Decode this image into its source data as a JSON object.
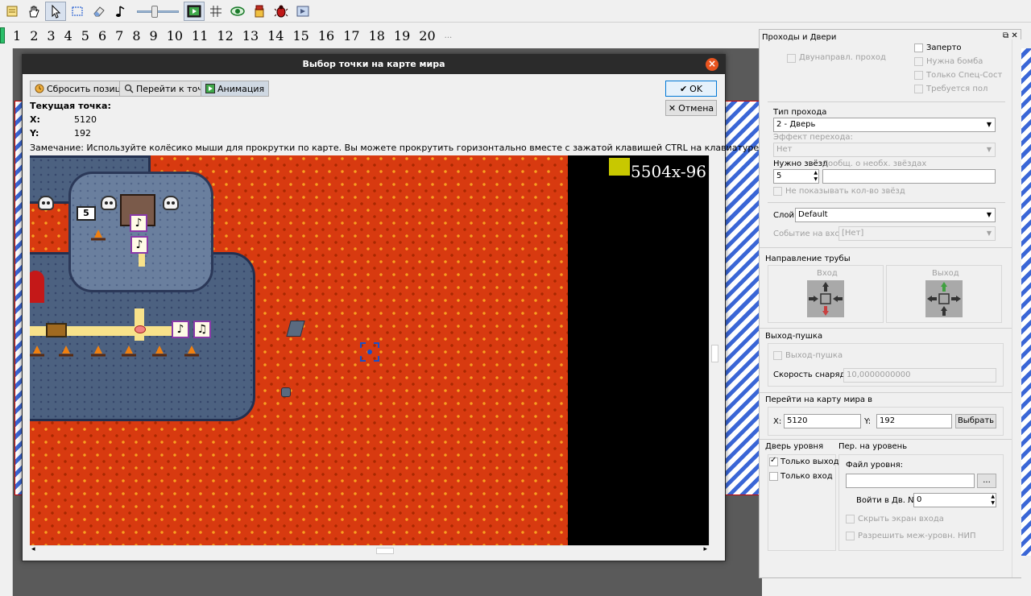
{
  "toolbar": {
    "icons": [
      "list-icon",
      "hand-icon",
      "pointer-icon",
      "select-rect-icon",
      "eraser-icon",
      "music-note-icon",
      "zoom-slider",
      "play-level-icon",
      "grid-icon",
      "eye-icon",
      "bucket-icon",
      "bug-icon",
      "animation-icon"
    ]
  },
  "layers": {
    "numbers": [
      "1",
      "2",
      "3",
      "4",
      "5",
      "6",
      "7",
      "8",
      "9",
      "10",
      "11",
      "12",
      "13",
      "14",
      "15",
      "16",
      "17",
      "18",
      "19",
      "20"
    ],
    "more": "..."
  },
  "dialog": {
    "title": "Выбор точки на карте мира",
    "reset_position": "Сбросить позицию",
    "goto_point": "Перейти к точке",
    "animation": "Анимация",
    "ok": "OK",
    "cancel": "Отмена",
    "current_point_label": "Текущая точка:",
    "x_label": "X:",
    "x_value": "5120",
    "y_label": "Y:",
    "y_value": "192",
    "note": "Замечание: Используйте колёсико мыши для прокрутки по карте. Вы можете прокрутить горизонтально вместе с зажатой клавишей CTRL на клавиатуре.",
    "map_coord_text": "5504x-96"
  },
  "panel": {
    "title": "Проходы и Двери",
    "two_way": "Двунаправл. проход",
    "locked": "Заперто",
    "need_bomb": "Нужна бомба",
    "special_only": "Только Спец-Сост",
    "need_floor": "Требуется пол",
    "passage_type_label": "Тип прохода",
    "passage_type_value": "2 - Дверь",
    "passage_effect_label": "Эффект перехода:",
    "passage_effect_value": "Нет",
    "stars_needed_label": "Нужно звёзд",
    "stars_message_label": "Сообщ. о необх. звёздах",
    "stars_value": "5",
    "hide_star_count": "Не показывать кол-во звёзд",
    "layer_label": "Слой:",
    "layer_value": "Default",
    "enter_event_label": "Событие на вход:",
    "enter_event_value": "[Нет]",
    "pipe_direction_label": "Направление трубы",
    "pipe_in": "Вход",
    "pipe_out": "Выход",
    "cannon_label": "Выход-пушка",
    "cannon_check": "Выход-пушка",
    "projectile_speed_label": "Скорость снаряда:",
    "projectile_speed_value": "10,0000000000",
    "goto_world_label": "Перейти на карту мира в",
    "x_label": "X:",
    "x_value": "5120",
    "y_label": "Y:",
    "y_value": "192",
    "choose_button": "Выбрать",
    "level_door_label": "Дверь уровня",
    "exit_only": "Только выход",
    "entry_only": "Только вход",
    "to_level_label": "Пер. на уровень",
    "level_file_label": "Файл уровня:",
    "level_file_value": "",
    "browse_button": "...",
    "enter_door_label": "Войти в Дв. №",
    "enter_door_value": "0",
    "hide_entry_screen": "Скрыть экран входа",
    "allow_interlevel_npc": "Разрешить меж-уровн. НИП"
  },
  "colors": {
    "lava": "#d83a10",
    "dialog_title_bg": "#2b2b2b",
    "close_button": "#e9541f",
    "selection_accent": "#0078d7"
  }
}
